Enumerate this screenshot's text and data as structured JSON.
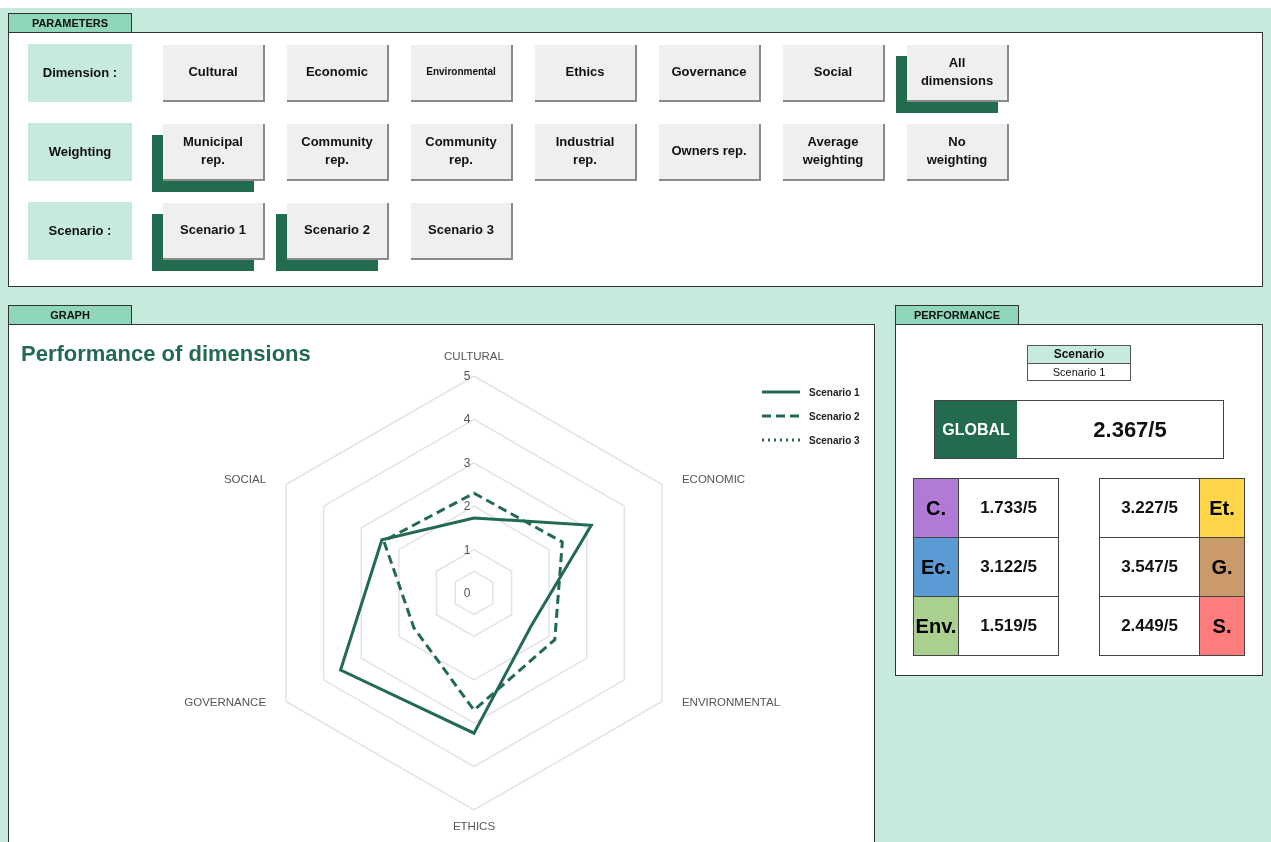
{
  "parameters": {
    "tab": "PARAMETERS",
    "rows": [
      {
        "label": "Dimension :",
        "options": [
          {
            "label": "Cultural",
            "selected": false
          },
          {
            "label": "Economic",
            "selected": false
          },
          {
            "label": "Environmental",
            "selected": false,
            "kind": "small"
          },
          {
            "label": "Ethics",
            "selected": false
          },
          {
            "label": "Governance",
            "selected": false
          },
          {
            "label": "Social",
            "selected": false
          },
          {
            "label": "All dimensions",
            "selected": true
          }
        ]
      },
      {
        "label": "Weighting",
        "options": [
          {
            "label": "Municipal rep.",
            "selected": true
          },
          {
            "label": "Community rep.",
            "selected": false
          },
          {
            "label": "Community rep.",
            "selected": false
          },
          {
            "label": "Industrial rep.",
            "selected": false
          },
          {
            "label": "Owners rep.",
            "selected": false
          },
          {
            "label": "Average weighting",
            "selected": false
          },
          {
            "label": "No weighting",
            "selected": false
          }
        ]
      },
      {
        "label": "Scenario :",
        "options": [
          {
            "label": "Scenario 1",
            "selected": true
          },
          {
            "label": "Scenario 2",
            "selected": true
          },
          {
            "label": "Scenario 3",
            "selected": false
          }
        ]
      }
    ]
  },
  "graph": {
    "tab": "GRAPH",
    "title": "Performance of dimensions",
    "axis_labels": [
      "CULTURAL",
      "ECONOMIC",
      "ENVIRONMENTAL",
      "ETHICS",
      "GOVERNANCE",
      "SOCIAL"
    ],
    "ticks": [
      "5",
      "4",
      "3",
      "2",
      "1",
      "0"
    ],
    "legend": [
      {
        "name": "Scenario 1",
        "kind": "solid"
      },
      {
        "name": "Scenario 2",
        "kind": "dashed"
      },
      {
        "name": "Scenario 3",
        "kind": "dotted"
      }
    ]
  },
  "performance": {
    "tab": "PERFORMANCE",
    "scenario_header": "Scenario",
    "scenario_value": "Scenario 1",
    "global_label": "GLOBAL",
    "global_value": "2.367/5",
    "left_scores": [
      {
        "label": "C.",
        "value": "1.733/5",
        "color": "#b07ad6"
      },
      {
        "label": "Ec.",
        "value": "3.122/5",
        "color": "#5b9bd5"
      },
      {
        "label": "Env.",
        "value": "1.519/5",
        "color": "#a9d08e"
      }
    ],
    "right_scores": [
      {
        "label": "Et.",
        "value": "3.227/5",
        "color": "#ffd54a"
      },
      {
        "label": "G.",
        "value": "3.547/5",
        "color": "#c99a6a"
      },
      {
        "label": "S.",
        "value": "2.449/5",
        "color": "#ff7c7c"
      }
    ]
  }
}
